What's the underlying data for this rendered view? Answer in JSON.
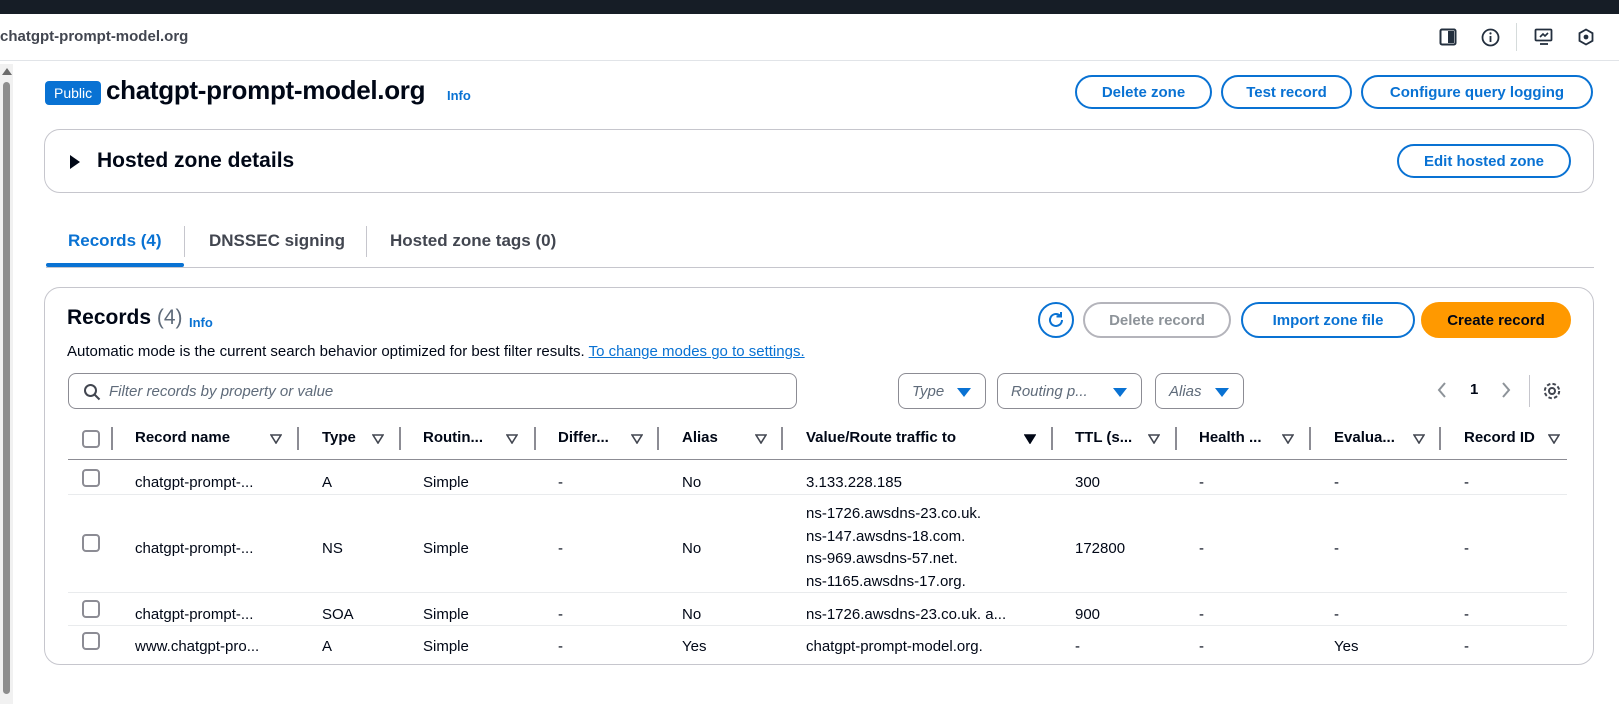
{
  "browser": {
    "domain": "chatgpt-prompt-model.org",
    "icons": [
      "sidebar-toggle-icon",
      "info-circle-icon",
      "screen-share-icon",
      "extension-icon"
    ]
  },
  "header": {
    "badge": "Public",
    "title": "chatgpt-prompt-model.org",
    "info": "Info",
    "buttons": {
      "delete_zone": "Delete zone",
      "test_record": "Test record",
      "configure_query_logging": "Configure query logging"
    }
  },
  "details": {
    "title": "Hosted zone details",
    "edit_button": "Edit hosted zone"
  },
  "tabs": [
    {
      "label": "Records (4)",
      "active": true
    },
    {
      "label": "DNSSEC signing",
      "active": false
    },
    {
      "label": "Hosted zone tags (0)",
      "active": false
    }
  ],
  "records": {
    "title": "Records",
    "count": "(4)",
    "info": "Info",
    "description": "Automatic mode is the current search behavior optimized for best filter results.",
    "settings_link": "To change modes go to settings.",
    "buttons": {
      "delete_record": "Delete record",
      "import_zone_file": "Import zone file",
      "create_record": "Create record"
    },
    "search_placeholder": "Filter records by property or value",
    "filters": {
      "type": "Type",
      "routing": "Routing p...",
      "alias": "Alias"
    },
    "page": "1",
    "columns": [
      "Record name",
      "Type",
      "Routin...",
      "Differ...",
      "Alias",
      "Value/Route traffic to",
      "TTL (s...",
      "Health ...",
      "Evalua...",
      "Record ID"
    ],
    "rows": [
      {
        "name": "chatgpt-prompt-...",
        "type": "A",
        "routing": "Simple",
        "differ": "-",
        "alias": "No",
        "value": [
          "3.133.228.185"
        ],
        "ttl": "300",
        "health": "-",
        "evaluate": "-",
        "record_id": "-"
      },
      {
        "name": "chatgpt-prompt-...",
        "type": "NS",
        "routing": "Simple",
        "differ": "-",
        "alias": "No",
        "value": [
          "ns-1726.awsdns-23.co.uk.",
          "ns-147.awsdns-18.com.",
          "ns-969.awsdns-57.net.",
          "ns-1165.awsdns-17.org."
        ],
        "ttl": "172800",
        "health": "-",
        "evaluate": "-",
        "record_id": "-"
      },
      {
        "name": "chatgpt-prompt-...",
        "type": "SOA",
        "routing": "Simple",
        "differ": "-",
        "alias": "No",
        "value": [
          "ns-1726.awsdns-23.co.uk. a..."
        ],
        "ttl": "900",
        "health": "-",
        "evaluate": "-",
        "record_id": "-"
      },
      {
        "name": "www.chatgpt-pro...",
        "type": "A",
        "routing": "Simple",
        "differ": "-",
        "alias": "Yes",
        "value": [
          "chatgpt-prompt-model.org."
        ],
        "ttl": "-",
        "health": "-",
        "evaluate": "Yes",
        "record_id": "-"
      }
    ]
  },
  "colors": {
    "accent": "#0972d3",
    "primary_button": "#ff9900",
    "top_bar": "#161d26",
    "text": "#000716"
  }
}
